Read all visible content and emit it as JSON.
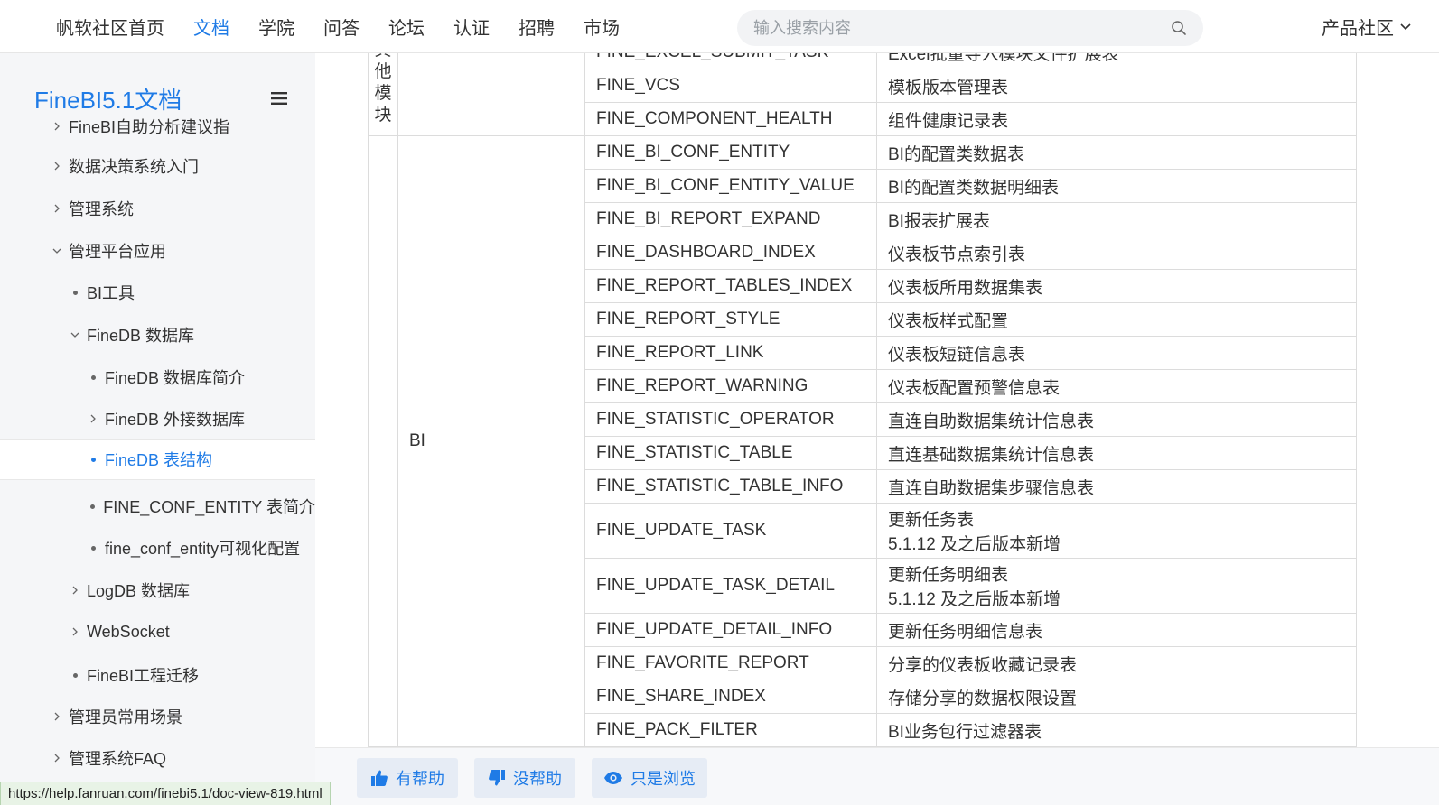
{
  "nav": {
    "items": [
      {
        "label": "帆软社区首页",
        "active": false
      },
      {
        "label": "文档",
        "active": true
      },
      {
        "label": "学院",
        "active": false
      },
      {
        "label": "问答",
        "active": false
      },
      {
        "label": "论坛",
        "active": false
      },
      {
        "label": "认证",
        "active": false
      },
      {
        "label": "招聘",
        "active": false
      },
      {
        "label": "市场",
        "active": false
      }
    ],
    "search_placeholder": "输入搜索内容",
    "community_label": "产品社区"
  },
  "sidebar": {
    "title": "FineBI5.1文档",
    "items": [
      {
        "label": "FineBI自助分析建议指",
        "mark": "chevron-right",
        "level": 0
      },
      {
        "label": "数据决策系统入门",
        "mark": "chevron-right",
        "level": 0
      },
      {
        "label": "管理系统",
        "mark": "chevron-right",
        "level": 0
      },
      {
        "label": "管理平台应用",
        "mark": "chevron-down",
        "level": 0
      },
      {
        "label": "BI工具",
        "mark": "dot",
        "level": 1
      },
      {
        "label": "FineDB 数据库",
        "mark": "chevron-down",
        "level": 1
      },
      {
        "label": "FineDB 数据库简介",
        "mark": "dot",
        "level": 2
      },
      {
        "label": "FineDB 外接数据库",
        "mark": "chevron-right",
        "level": 2
      },
      {
        "label": "FineDB 表结构",
        "mark": "dot",
        "level": 2,
        "selected": true
      },
      {
        "label": "FINE_CONF_ENTITY 表简介",
        "mark": "dot",
        "level": 2
      },
      {
        "label": "fine_conf_entity可视化配置",
        "mark": "dot",
        "level": 2
      },
      {
        "label": "LogDB 数据库",
        "mark": "chevron-right",
        "level": 1
      },
      {
        "label": "WebSocket",
        "mark": "chevron-right",
        "level": 1
      },
      {
        "label": "FineBI工程迁移",
        "mark": "dot",
        "level": 1
      },
      {
        "label": "管理员常用场景",
        "mark": "chevron-right",
        "level": 0
      },
      {
        "label": "管理系统FAQ",
        "mark": "chevron-right",
        "level": 0
      }
    ]
  },
  "table": {
    "group_other": "其他模块",
    "group_bi": "BI",
    "rows_other": [
      {
        "name": "FINE_EXCEL_SUBMIT_TASK",
        "desc": "Excel批量导入模块文件扩展表"
      },
      {
        "name": "FINE_VCS",
        "desc": "模板版本管理表"
      },
      {
        "name": "FINE_COMPONENT_HEALTH",
        "desc": "组件健康记录表"
      }
    ],
    "rows_bi": [
      {
        "name": "FINE_BI_CONF_ENTITY",
        "desc": "BI的配置类数据表"
      },
      {
        "name": "FINE_BI_CONF_ENTITY_VALUE",
        "desc": "BI的配置类数据明细表"
      },
      {
        "name": "FINE_BI_REPORT_EXPAND",
        "desc": "BI报表扩展表"
      },
      {
        "name": "FINE_DASHBOARD_INDEX",
        "desc": "仪表板节点索引表"
      },
      {
        "name": "FINE_REPORT_TABLES_INDEX",
        "desc": "仪表板所用数据集表"
      },
      {
        "name": "FINE_REPORT_STYLE",
        "desc": "仪表板样式配置"
      },
      {
        "name": "FINE_REPORT_LINK",
        "desc": "仪表板短链信息表"
      },
      {
        "name": "FINE_REPORT_WARNING",
        "desc": "仪表板配置预警信息表"
      },
      {
        "name": "FINE_STATISTIC_OPERATOR",
        "desc": "直连自助数据集统计信息表"
      },
      {
        "name": "FINE_STATISTIC_TABLE",
        "desc": "直连基础数据集统计信息表"
      },
      {
        "name": "FINE_STATISTIC_TABLE_INFO",
        "desc": "直连自助数据集步骤信息表"
      },
      {
        "name": "FINE_UPDATE_TASK",
        "desc": "更新任务表",
        "note": "5.1.12 及之后版本新增"
      },
      {
        "name": "FINE_UPDATE_TASK_DETAIL",
        "desc": "更新任务明细表",
        "note": "5.1.12 及之后版本新增"
      },
      {
        "name": "FINE_UPDATE_DETAIL_INFO",
        "desc": "更新任务明细信息表"
      },
      {
        "name": "FINE_FAVORITE_REPORT",
        "desc": "分享的仪表板收藏记录表"
      },
      {
        "name": "FINE_SHARE_INDEX",
        "desc": "存储分享的数据权限设置"
      },
      {
        "name": "FINE_PACK_FILTER",
        "desc": "BI业务包行过滤器表"
      }
    ]
  },
  "feedback": {
    "helpful": "有帮助",
    "not_helpful": "没帮助",
    "just_browsing": "只是浏览"
  },
  "status_url": "https://help.fanruan.com/finebi5.1/doc-view-819.html",
  "colors": {
    "accent": "#1f7be6"
  }
}
